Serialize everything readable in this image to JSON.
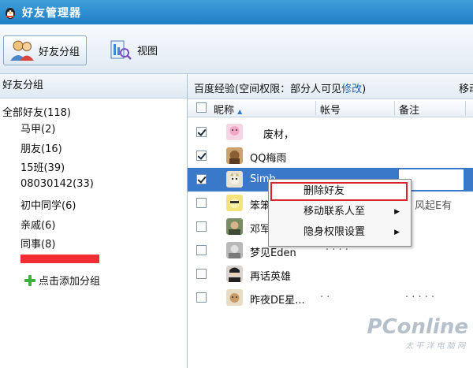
{
  "window": {
    "title": "好友管理器"
  },
  "toolbar": {
    "group_button": {
      "label": "好友分组",
      "icon": "two-users-icon"
    },
    "view_button": {
      "label": "视图",
      "icon": "view-icon"
    }
  },
  "left_panel": {
    "header": "好友分组",
    "root": "全部好友(118)",
    "groups": [
      "马甲(2)",
      "朋友(16)",
      "15班(39)",
      "08030142(33)",
      "初中同学(6)",
      "亲戚(6)",
      "同事(8)"
    ],
    "add_group": "点击添加分组"
  },
  "right_panel": {
    "info": {
      "prefix": "百度经验(空间权限：部分人可见",
      "link": "修改",
      "suffix": ")"
    },
    "move_label": "移动",
    "columns": {
      "nickname": "昵称",
      "account": "帐号",
      "remark": "备注"
    },
    "rows": [
      {
        "nickname": "废材，",
        "checked": true,
        "selected": false,
        "extra": ""
      },
      {
        "nickname": "QQ梅雨",
        "checked": true,
        "selected": false,
        "extra": ""
      },
      {
        "nickname": "Simb",
        "checked": true,
        "selected": true,
        "extra": ""
      },
      {
        "nickname": "笨笨",
        "checked": false,
        "selected": false,
        "extra": "风起E有"
      },
      {
        "nickname": "邓军",
        "checked": false,
        "selected": false,
        "extra": ""
      },
      {
        "nickname": "梦见Eden",
        "checked": false,
        "selected": false,
        "extra": ""
      },
      {
        "nickname": "再话英雄",
        "checked": false,
        "selected": false,
        "extra": ""
      },
      {
        "nickname": "昨夜DE星...",
        "checked": false,
        "selected": false,
        "extra": ""
      }
    ]
  },
  "context_menu": {
    "items": [
      {
        "label": "删除好友",
        "submenu": false,
        "highlight": true
      },
      {
        "label": "移动联系人至",
        "submenu": true,
        "highlight": false
      },
      {
        "label": "隐身权限设置",
        "submenu": true,
        "highlight": false
      }
    ]
  },
  "watermark": {
    "brand": "PConline",
    "sub": "太 平 洋 电 脑 网"
  },
  "colors": {
    "titlebar": "#2a8ad0",
    "selection": "#3a78c9",
    "redaction": "#f22d33",
    "menu_highlight": "#d9232d",
    "link": "#1a5fb4"
  }
}
